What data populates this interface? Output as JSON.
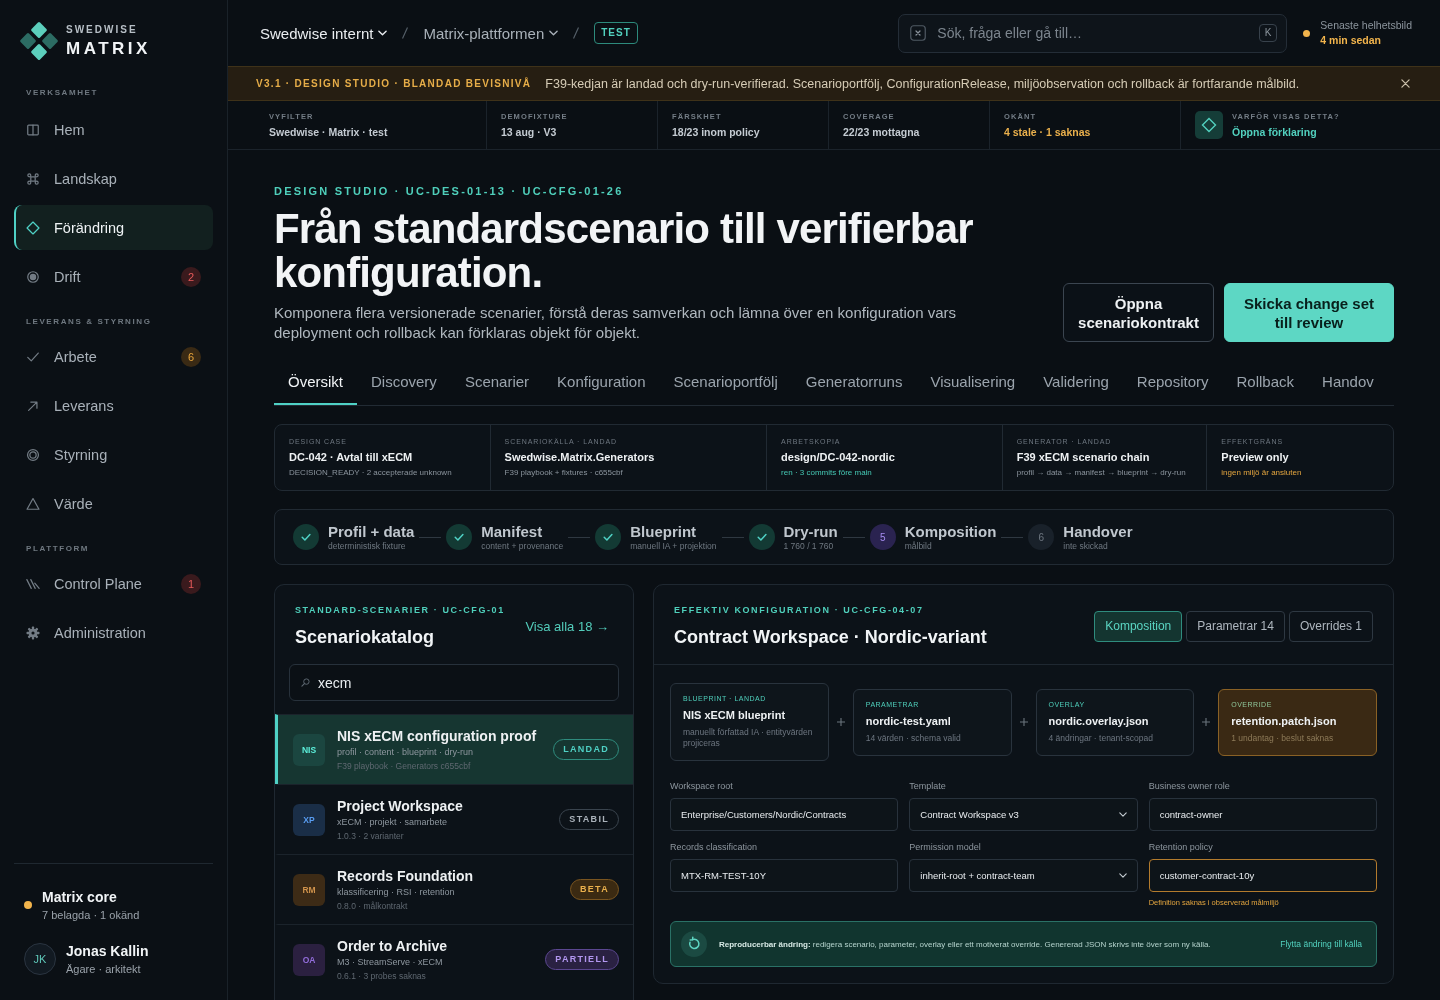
{
  "sidebar": {
    "brand": {
      "company": "SWEDWISE",
      "product": "MATRIX"
    },
    "sections": [
      {
        "title": "VERKSAMHET",
        "items": [
          {
            "label": "Hem",
            "selected": false
          },
          {
            "label": "Landskap",
            "selected": false
          },
          {
            "label": "Förändring",
            "selected": true
          },
          {
            "label": "Drift",
            "selected": false,
            "badge": {
              "text": "2",
              "kind": "alert"
            }
          }
        ]
      },
      {
        "title": "LEVERANS & STYRNING",
        "items": [
          {
            "label": "Arbete",
            "selected": false,
            "badge": {
              "text": "6",
              "kind": "warning"
            }
          },
          {
            "label": "Leverans",
            "selected": false
          },
          {
            "label": "Styrning",
            "selected": false
          },
          {
            "label": "Värde",
            "selected": false
          }
        ]
      },
      {
        "title": "PLATTFORM",
        "items": [
          {
            "label": "Control Plane",
            "selected": false,
            "badge": {
              "text": "1",
              "kind": "alert"
            }
          },
          {
            "label": "Administration",
            "selected": false
          }
        ]
      }
    ],
    "workspace": {
      "name": "Matrix core",
      "detail": "7 belagda · 1 okänd",
      "color": "#f2b44c"
    },
    "user": {
      "initials": "JK",
      "name": "Jonas Kallin",
      "role": "Ägare · arkitekt"
    }
  },
  "topbar": {
    "breadcrumb": [
      {
        "label": "Swedwise internt"
      },
      {
        "label": "Matrix-plattformen"
      }
    ],
    "environment": "TEST",
    "search": {
      "placeholder": "Sök, fråga eller gå till…",
      "shortcut": "K"
    },
    "snapshot": {
      "label": "Senaste helhetsbild",
      "age": "4 min sedan",
      "color": "#f2b44c"
    }
  },
  "banner": {
    "tag": "V3.1 · DESIGN STUDIO · BLANDAD BEVISNIVÅ",
    "message": "F39-kedjan är landad och dry-run-verifierad. Scenarioportfölj, ConfigurationRelease, miljöobservation och rollback är fortfarande målbild."
  },
  "context_strip": [
    {
      "label": "VYFILTER",
      "value": "Swedwise · Matrix · test",
      "kind": "plain"
    },
    {
      "label": "DEMOFIXTURE",
      "value": "13 aug · V3",
      "kind": "plain"
    },
    {
      "label": "FÄRSKHET",
      "value": "18/23 inom policy",
      "kind": "plain"
    },
    {
      "label": "COVERAGE",
      "value": "22/23 mottagna",
      "kind": "plain"
    },
    {
      "label": "OKÄNT",
      "value": "4 stale · 1 saknas",
      "kind": "warning"
    },
    {
      "label": "VARFÖR VISAS DETTA?",
      "value": "Öppna förklaring",
      "kind": "link"
    }
  ],
  "hero": {
    "eyebrow": "DESIGN STUDIO · UC-DES-01-13 · UC-CFG-01-26",
    "title": "Från standardscenario till verifierbar konfiguration.",
    "description": "Komponera flera versionerade scenarier, förstå deras samverkan och lämna över en konfiguration vars deployment och rollback kan förklaras objekt för objekt.",
    "actions": [
      {
        "label": "Öppna scenariokontrakt",
        "kind": "secondary"
      },
      {
        "label": "Skicka change set till review",
        "kind": "primary"
      }
    ]
  },
  "tabs": [
    {
      "label": "Översikt",
      "selected": true
    },
    {
      "label": "Discovery",
      "selected": false
    },
    {
      "label": "Scenarier",
      "selected": false
    },
    {
      "label": "Konfiguration",
      "selected": false
    },
    {
      "label": "Scenarioportfölj",
      "selected": false
    },
    {
      "label": "Generatorruns",
      "selected": false
    },
    {
      "label": "Visualisering",
      "selected": false
    },
    {
      "label": "Validering",
      "selected": false
    },
    {
      "label": "Repository",
      "selected": false
    },
    {
      "label": "Rollback",
      "selected": false
    },
    {
      "label": "Handov",
      "selected": false
    }
  ],
  "case_summary": [
    {
      "label": "DESIGN CASE",
      "value": "DC-042 · Avtal till xECM",
      "detail": "DECISION_READY · 2 accepterade unknown",
      "kind": "plain"
    },
    {
      "label": "SCENARIOKÄLLA · LANDAD",
      "value": "Swedwise.Matrix.Generators",
      "detail": "F39 playbook + fixtures · c655cbf",
      "kind": "plain"
    },
    {
      "label": "ARBETSKOPIA",
      "value": "design/DC-042-nordic",
      "detail": "ren · 3 commits före main",
      "kind": "ok"
    },
    {
      "label": "GENERATOR · LANDAD",
      "value": "F39 xECM scenario chain",
      "detail": "profil → data → manifest → blueprint → dry-run",
      "kind": "plain"
    },
    {
      "label": "EFFEKTGRÄNS",
      "value": "Preview only",
      "detail": "ingen miljö är ansluten",
      "kind": "warning"
    }
  ],
  "pipeline": [
    {
      "name": "Profil + data",
      "detail": "deterministisk fixture",
      "kind": "done"
    },
    {
      "name": "Manifest",
      "detail": "content + provenance",
      "kind": "done"
    },
    {
      "name": "Blueprint",
      "detail": "manuell IA + projektion",
      "kind": "done"
    },
    {
      "name": "Dry-run",
      "detail": "1 760 / 1 760",
      "kind": "done"
    },
    {
      "name": "Komposition",
      "detail": "målbild",
      "kind": "current",
      "number": "5"
    },
    {
      "name": "Handover",
      "detail": "inte skickad",
      "kind": "pending",
      "number": "6"
    }
  ],
  "catalog": {
    "eyebrow": "STANDARD-SCENARIER · UC-CFG-01",
    "title": "Scenariokatalog",
    "link": "Visa alla 18 →",
    "search": {
      "value": "xecm"
    },
    "scenarios": [
      {
        "initials": "NIS",
        "name": "NIS xECM configuration proof",
        "tags": "profil · content · blueprint · dry-run",
        "meta": "F39 playbook · Generators c655cbf",
        "badge": {
          "text": "LANDAD",
          "kind": "landed"
        },
        "color": "#1b4640",
        "selected": true
      },
      {
        "initials": "XP",
        "name": "Project Workspace",
        "tags": "xECM · projekt · samarbete",
        "meta": "1.0.3 · 2 varianter",
        "badge": {
          "text": "STABIL",
          "kind": "stable"
        },
        "color": "#1a2e47",
        "selected": false
      },
      {
        "initials": "RM",
        "name": "Records Foundation",
        "tags": "klassificering · RSI · retention",
        "meta": "0.8.0 · målkontrakt",
        "badge": {
          "text": "BETA",
          "kind": "beta"
        },
        "color": "#3d2b16",
        "selected": false
      },
      {
        "initials": "OA",
        "name": "Order to Archive",
        "tags": "M3 · StreamServe · xECM",
        "meta": "0.6.1 · 3 probes saknas",
        "badge": {
          "text": "PARTIELL",
          "kind": "partial"
        },
        "color": "#2b2040",
        "selected": false
      }
    ]
  },
  "configuration": {
    "eyebrow": "EFFEKTIV KONFIGURATION · UC-CFG-04-07",
    "title": "Contract Workspace · Nordic-variant",
    "views": [
      {
        "label": "Komposition",
        "selected": true
      },
      {
        "label": "Parametrar 14",
        "selected": false
      },
      {
        "label": "Overrides 1",
        "selected": false
      }
    ],
    "layers": [
      {
        "label": "BLUEPRINT · LANDAD",
        "name": "NIS xECM blueprint",
        "detail": "manuellt författad IA · entityvärden projiceras",
        "kind": "layer"
      },
      {
        "label": "PARAMETRAR",
        "name": "nordic-test.yaml",
        "detail": "14 värden · schema valid",
        "kind": "layer"
      },
      {
        "label": "OVERLAY",
        "name": "nordic.overlay.json",
        "detail": "4 ändringar · tenant-scopad",
        "kind": "layer"
      },
      {
        "label": "OVERRIDE",
        "name": "retention.patch.json",
        "detail": "1 undantag · beslut saknas",
        "kind": "override"
      }
    ],
    "fields": [
      {
        "label": "Workspace root",
        "value": "Enterprise/Customers/Nordic/Contracts",
        "kind": "text",
        "invalid": false
      },
      {
        "label": "Template",
        "value": "Contract Workspace v3",
        "kind": "select",
        "invalid": false
      },
      {
        "label": "Business owner role",
        "value": "contract-owner",
        "kind": "text",
        "invalid": false
      },
      {
        "label": "Records classification",
        "value": "MTX-RM-TEST-10Y",
        "kind": "text",
        "invalid": false
      },
      {
        "label": "Permission model",
        "value": "inherit-root + contract-team",
        "kind": "select",
        "invalid": false
      },
      {
        "label": "Retention policy",
        "value": "customer-contract-10y",
        "kind": "text",
        "invalid": true,
        "hint": "Definition saknas i observerad målmiljö"
      }
    ],
    "notice": {
      "text": "**Reproducerbar ändring:** redigera scenario, parameter, overlay eller ett motiverat override. Genererad JSON skrivs inte över som ny källa.",
      "link": "Flytta ändring till källa"
    }
  }
}
